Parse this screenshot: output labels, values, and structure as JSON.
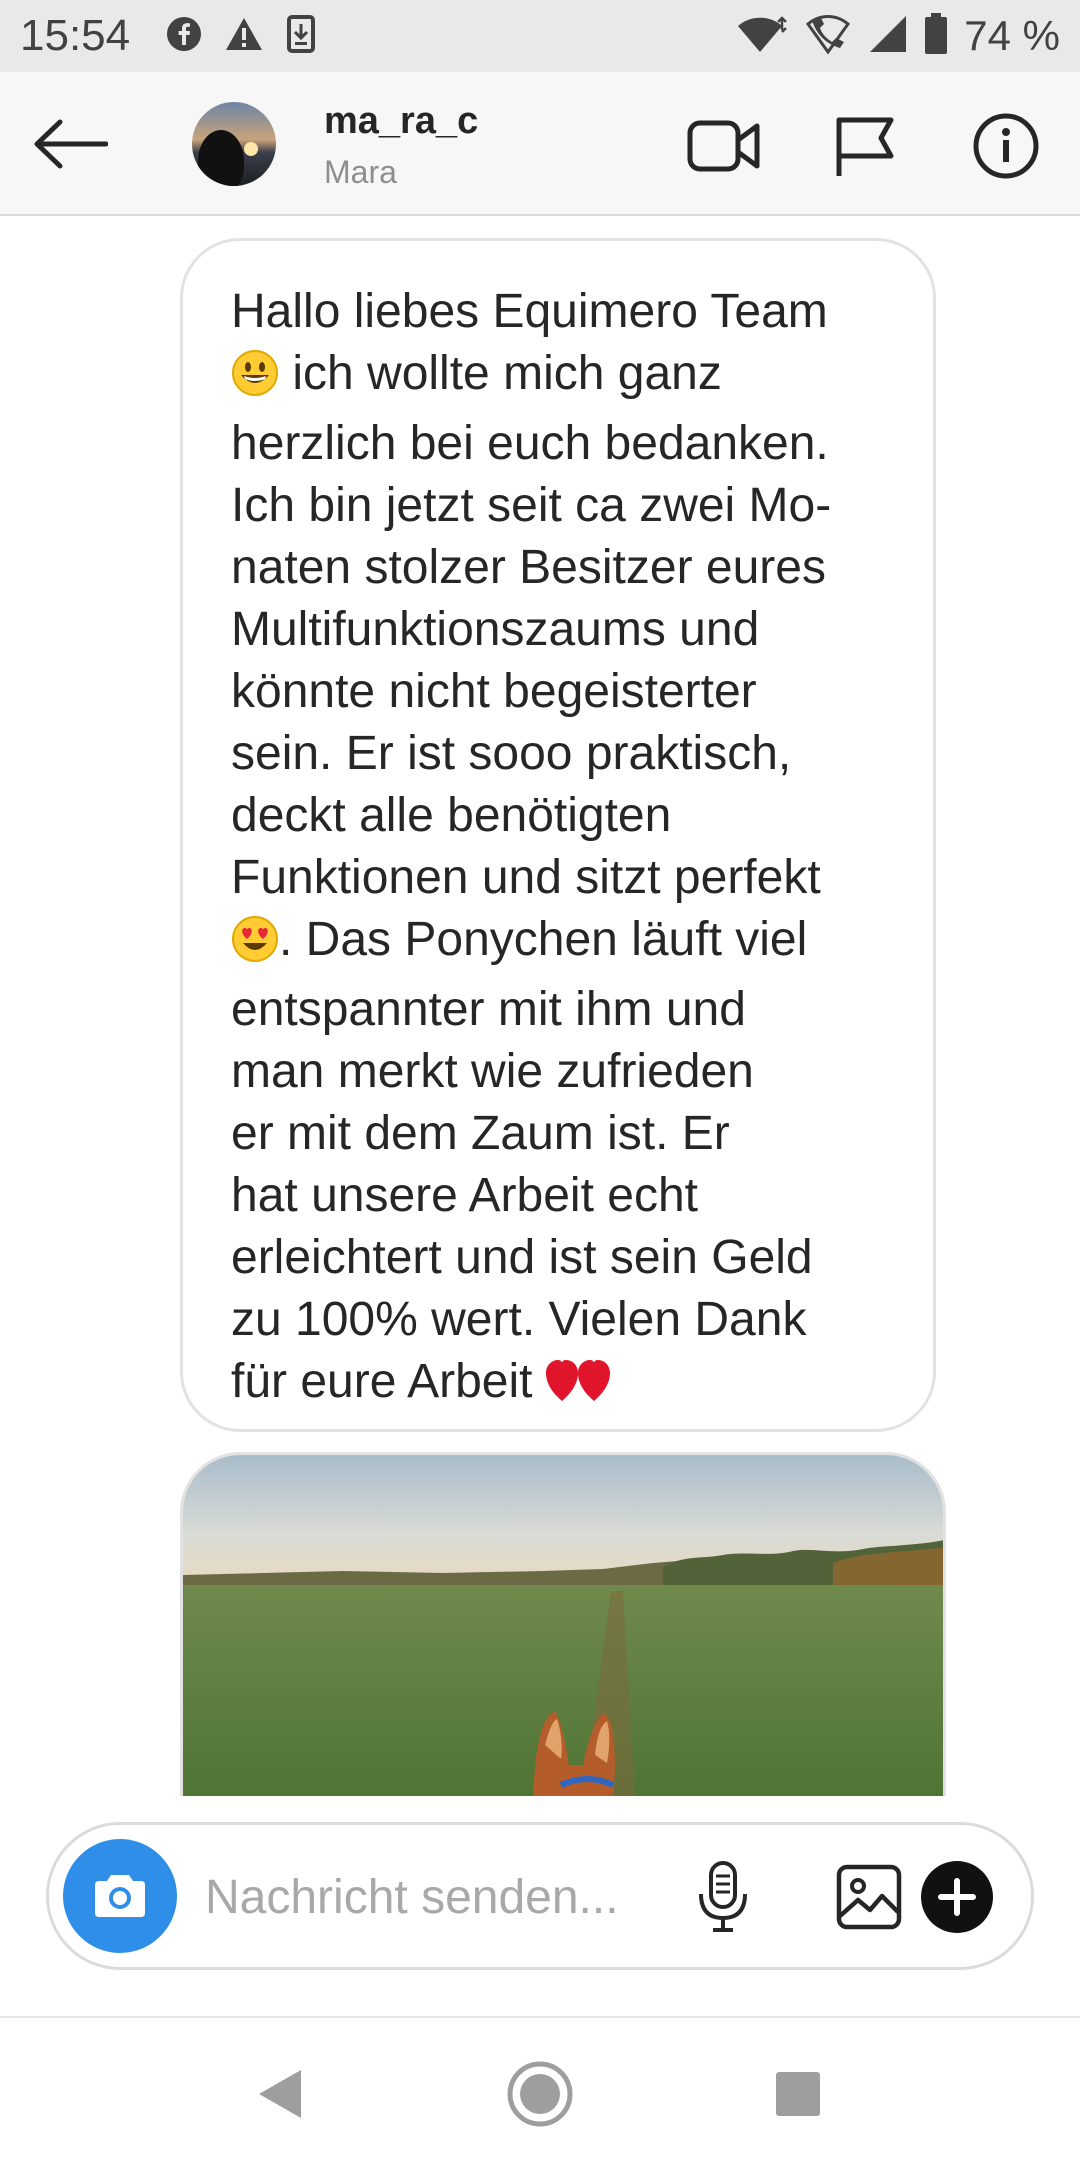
{
  "status_bar": {
    "time": "15:54",
    "battery_percent": "74 %",
    "left_icons": [
      "facebook-icon",
      "warning-icon",
      "download-icon"
    ],
    "right_icons": [
      "wifi-icon",
      "wifi-calling-icon",
      "signal-icon",
      "battery-icon"
    ]
  },
  "header": {
    "username": "ma_ra_c",
    "full_name": "Mara",
    "icons": [
      "back-arrow-icon",
      "video-call-icon",
      "flag-icon",
      "info-icon"
    ]
  },
  "messages": [
    {
      "type": "text",
      "lines": [
        "Hallo liebes Equimero Team",
        " ich wollte mich ganz",
        "herzlich bei euch bedanken.",
        "Ich bin jetzt seit ca zwei Mo-",
        "naten stolzer Besitzer eures",
        "Multifunktionszaums und",
        "könnte nicht begeisterter",
        "sein. Er ist sooo praktisch,",
        "deckt alle benötigten",
        "Funktionen und sitzt perfekt",
        ". Das Ponychen läuft viel",
        "entspannter mit ihm und",
        "man merkt wie zufrieden",
        "er mit dem Zaum ist. Er",
        "hat unsere Arbeit echt",
        "erleichtert und ist sein Geld",
        "zu 100% wert. Vielen Dank",
        "für eure Arbeit "
      ],
      "emojis": [
        "grinning-face-emoji",
        "heart-eyes-emoji",
        "red-heart-emoji"
      ]
    },
    {
      "type": "photo",
      "description_icon": "photo-field-horse-ears"
    }
  ],
  "composer": {
    "placeholder": "Nachricht senden...",
    "icons": [
      "camera-icon",
      "microphone-icon",
      "gallery-icon",
      "plus-icon"
    ]
  },
  "nav_bar": {
    "icons": [
      "back-triangle-icon",
      "home-circle-icon",
      "recents-square-icon"
    ]
  },
  "colors": {
    "accent_blue": "#2f8fe8",
    "status_bar_bg": "#e9e9e9",
    "header_bg": "#f7f7f7",
    "text_primary": "#262626",
    "text_secondary": "#8e8e8e"
  }
}
